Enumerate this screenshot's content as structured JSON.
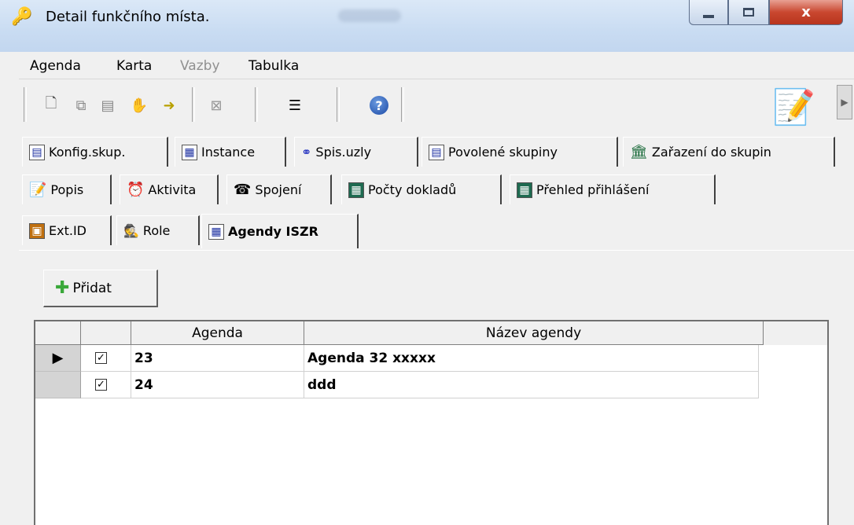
{
  "window": {
    "title": "Detail funkčního místa.",
    "close_glyph": "x"
  },
  "menu": {
    "items": [
      "Agenda",
      "Karta",
      "Vazby",
      "Tabulka"
    ]
  },
  "tabs": {
    "row1": [
      "Konfig.skup.",
      "Instance",
      "Spis.uzly",
      "Povolené skupiny",
      "Zařazení do skupin"
    ],
    "row2": [
      "Popis",
      "Aktivita",
      "Spojení",
      "Počty dokladů",
      "Přehled přihlášení"
    ],
    "row3": [
      "Ext.ID",
      "Role",
      "Agendy ISZR"
    ]
  },
  "add_button": {
    "label": "Přidat"
  },
  "grid": {
    "columns": [
      "Agenda",
      "Název agendy"
    ],
    "rows": [
      {
        "checked": true,
        "agenda": "23",
        "name": "Agenda 32 xxxxx"
      },
      {
        "checked": true,
        "agenda": "24",
        "name": "ddd"
      }
    ]
  }
}
